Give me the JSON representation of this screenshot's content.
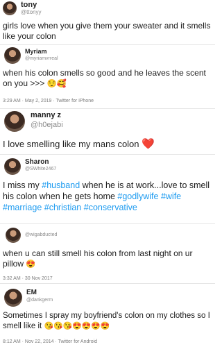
{
  "tweets": [
    {
      "name": "tony",
      "handle": "@ttonyy",
      "text": "girls love when you give them your sweater and it smells like your colon",
      "meta": ""
    },
    {
      "name": "Myriam",
      "handle": "@myriamvrreal",
      "text": "when his colon smells so good and he leaves the scent on you >>>",
      "emoji": "😌🥰",
      "meta": "3:29 AM · May 2, 2019 · Twitter for iPhone"
    },
    {
      "name": "manny z",
      "handle": "@h0ejabi",
      "text": "I love smelling like my mans colon",
      "emoji": "❤️"
    },
    {
      "name": "Sharon",
      "handle": "@SWhite2467",
      "text_parts": [
        "I miss my ",
        "#husband",
        " when he is at work...love to smell his colon when he gets home ",
        "#godlywife",
        " ",
        "#wife",
        " ",
        "#marriage",
        " ",
        "#christian",
        " ",
        "#conservative"
      ]
    },
    {
      "name": "",
      "handle": "@wigabducted",
      "text": "when u can still smell his colon from last night on ur pillow",
      "emoji": "😍",
      "meta": "3:32 AM · 30 Nov 2017"
    },
    {
      "name": "EM",
      "handle": "@dankgerm",
      "text": "Sometimes I spray my boyfriend's colon on my clothes so I smell like it",
      "emoji": "😘😘😘😍😍😍😍",
      "meta": "8:12 AM · Nov 22, 2014 · Twitter for Android"
    }
  ]
}
